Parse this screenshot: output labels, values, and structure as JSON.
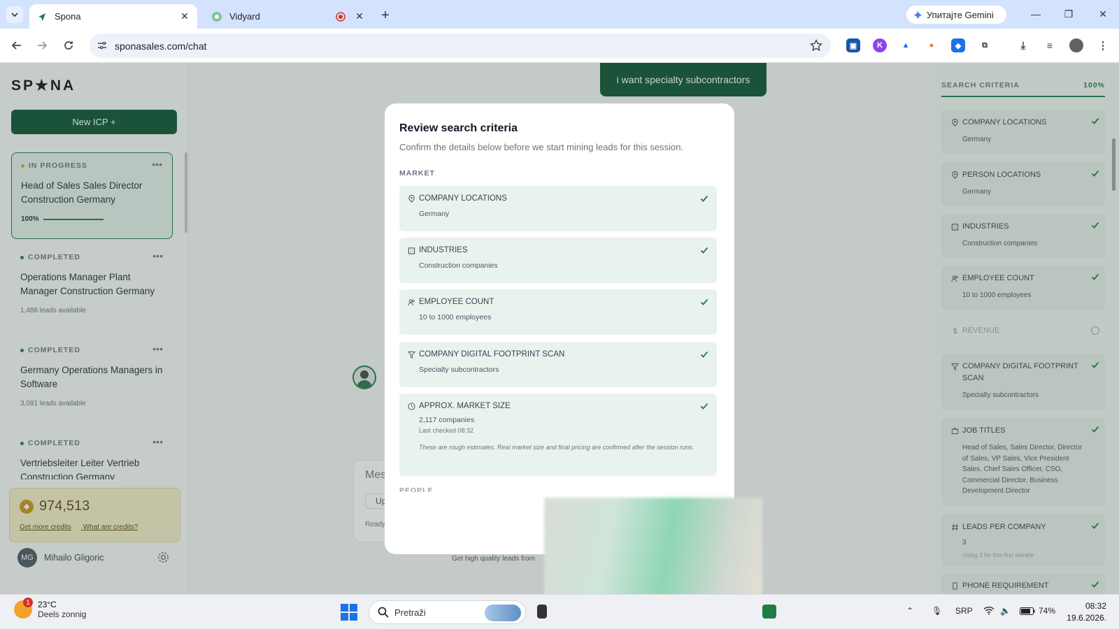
{
  "browser": {
    "tabs": [
      {
        "title": "Spona",
        "active": true
      },
      {
        "title": "Vidyard",
        "active": false
      }
    ],
    "gemini_label": "Упитајте Gemini",
    "url": "sponasales.com/chat"
  },
  "app": {
    "logo": "SP★NA",
    "new_icp_label": "New ICP  +",
    "icps": [
      {
        "status": "IN PROGRESS",
        "name": "Head of Sales Sales Director Construction Germany",
        "progress": "100%",
        "progress_value": 1.0
      },
      {
        "status": "COMPLETED",
        "name": "Operations Manager Plant Manager Construction Germany",
        "meta": "1,488 leads available"
      },
      {
        "status": "COMPLETED",
        "name": "Germany Operations Managers in Software",
        "meta": "3,091 leads available"
      },
      {
        "status": "COMPLETED",
        "name": "Vertriebsleiter Leiter Vertrieb Construction Germany"
      }
    ],
    "credits": {
      "amount": "974,513",
      "get_more": "Get more credits",
      "what_are": "What are credits?"
    },
    "user": {
      "initials": "MG",
      "name": "Mihailo Gligoric"
    },
    "chat": {
      "user_message": "i want specialty subcontractors",
      "input_placeholder": "Mes",
      "upload_label": "Up",
      "ready": "Ready",
      "tagline": "Get high quality leads from"
    }
  },
  "criteria_panel": {
    "title": "SEARCH CRITERIA",
    "percent": "100%",
    "items": [
      {
        "label": "COMPANY LOCATIONS",
        "value": "Germany",
        "done": true
      },
      {
        "label": "PERSON LOCATIONS",
        "value": "Germany",
        "done": true
      },
      {
        "label": "INDUSTRIES",
        "value": "Construction companies",
        "done": true
      },
      {
        "label": "EMPLOYEE COUNT",
        "value": "10 to 1000 employees",
        "done": true
      },
      {
        "label": "REVENUE",
        "value": "",
        "done": false
      },
      {
        "label": "COMPANY DIGITAL FOOTPRINT SCAN",
        "value": "Specialty subcontractors",
        "done": true
      },
      {
        "label": "JOB TITLES",
        "value": "Head of Sales, Sales Director, Director of Sales, VP Sales, Vice President Sales, Chief Sales Officer, CSO, Commercial Director, Business Development Director",
        "done": true
      },
      {
        "label": "LEADS PER COMPANY",
        "value": "3",
        "sub": "Using 3 for this first sample",
        "done": true
      },
      {
        "label": "PHONE REQUIREMENT",
        "value": "",
        "done": true
      }
    ]
  },
  "modal": {
    "title": "Review search criteria",
    "subtitle": "Confirm the details below before we start mining leads for this session.",
    "section_market": "MARKET",
    "section_next": "PEOPLE",
    "items": [
      {
        "label": "COMPANY LOCATIONS",
        "value": "Germany"
      },
      {
        "label": "INDUSTRIES",
        "value": "Construction companies"
      },
      {
        "label": "EMPLOYEE COUNT",
        "value": "10 to 1000 employees"
      },
      {
        "label": "COMPANY DIGITAL FOOTPRINT SCAN",
        "value": "Specialty subcontractors"
      },
      {
        "label": "APPROX. MARKET SIZE",
        "value": "2,117 companies",
        "last_checked": "Last checked 08:32",
        "note": "These are rough estimates. Real market size and final pricing are confirmed after the session runs."
      }
    ]
  },
  "taskbar": {
    "weather_temp": "23°C",
    "weather_desc": "Deels zonnig",
    "weather_badge": "1",
    "search_label": "Pretraži",
    "lang": "SRP",
    "battery": "74%",
    "time": "08:32",
    "date": "19.6.2026."
  },
  "colors": {
    "brand_green": "#0b5132",
    "accent_green": "#1d7a4d",
    "credits_bg": "#f6ecc8"
  }
}
